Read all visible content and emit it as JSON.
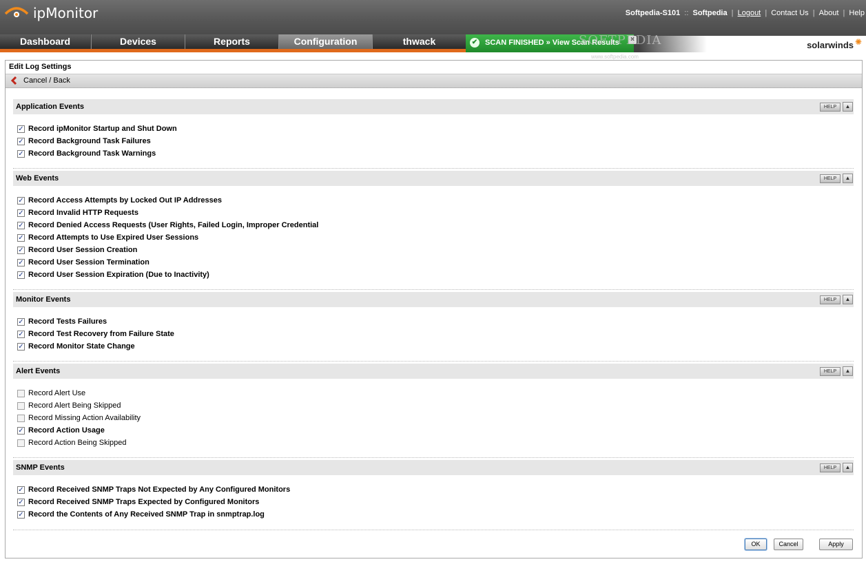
{
  "app": {
    "name": "ipMonitor"
  },
  "toplinks": {
    "user": "Softpedia-S101",
    "separator": "::",
    "account": "Softpedia",
    "logout": "Logout",
    "contact": "Contact Us",
    "about": "About",
    "help": "Help"
  },
  "nav": {
    "tabs": [
      {
        "label": "Dashboard"
      },
      {
        "label": "Devices"
      },
      {
        "label": "Reports"
      },
      {
        "label": "Configuration"
      },
      {
        "label": "thwack"
      }
    ],
    "active": "Configuration"
  },
  "scan_banner": {
    "text": "SCAN FINISHED » View Scan Results"
  },
  "watermark": {
    "text": "SOFTPEDIA",
    "sub": "www.softpedia.com"
  },
  "brand": {
    "text": "solarwinds"
  },
  "panel": {
    "title": "Edit Log Settings",
    "cancel_back": "Cancel / Back"
  },
  "help_label": "HELP",
  "sections": [
    {
      "title": "Application Events",
      "items": [
        {
          "label": "Record ipMonitor Startup and Shut Down",
          "checked": true
        },
        {
          "label": "Record Background Task Failures",
          "checked": true
        },
        {
          "label": "Record Background Task Warnings",
          "checked": true
        }
      ]
    },
    {
      "title": "Web Events",
      "items": [
        {
          "label": "Record Access Attempts by Locked Out IP Addresses",
          "checked": true
        },
        {
          "label": "Record Invalid HTTP Requests",
          "checked": true
        },
        {
          "label": "Record Denied Access Requests (User Rights, Failed Login, Improper Credential",
          "checked": true
        },
        {
          "label": "Record Attempts to Use Expired User Sessions",
          "checked": true
        },
        {
          "label": "Record User Session Creation",
          "checked": true
        },
        {
          "label": "Record User Session Termination",
          "checked": true
        },
        {
          "label": "Record User Session Expiration (Due to Inactivity)",
          "checked": true
        }
      ]
    },
    {
      "title": "Monitor Events",
      "items": [
        {
          "label": "Record Tests Failures",
          "checked": true
        },
        {
          "label": "Record Test Recovery from Failure State",
          "checked": true
        },
        {
          "label": "Record Monitor State Change",
          "checked": true
        }
      ]
    },
    {
      "title": "Alert Events",
      "items": [
        {
          "label": "Record Alert Use",
          "checked": false
        },
        {
          "label": "Record Alert Being Skipped",
          "checked": false
        },
        {
          "label": "Record Missing Action Availability",
          "checked": false
        },
        {
          "label": "Record Action Usage",
          "checked": true
        },
        {
          "label": "Record Action Being Skipped",
          "checked": false
        }
      ]
    },
    {
      "title": "SNMP Events",
      "items": [
        {
          "label": "Record Received SNMP Traps Not Expected by Any Configured Monitors",
          "checked": true
        },
        {
          "label": "Record Received SNMP Traps Expected by Configured Monitors",
          "checked": true
        },
        {
          "label": "Record the Contents of Any Received SNMP Trap in snmptrap.log",
          "checked": true
        }
      ]
    }
  ],
  "buttons": {
    "ok": "OK",
    "cancel": "Cancel",
    "apply": "Apply"
  },
  "colors": {
    "accent_orange": "#e06a1c",
    "scan_green": "#2a9e36",
    "section_bg": "#e6e6e6"
  }
}
